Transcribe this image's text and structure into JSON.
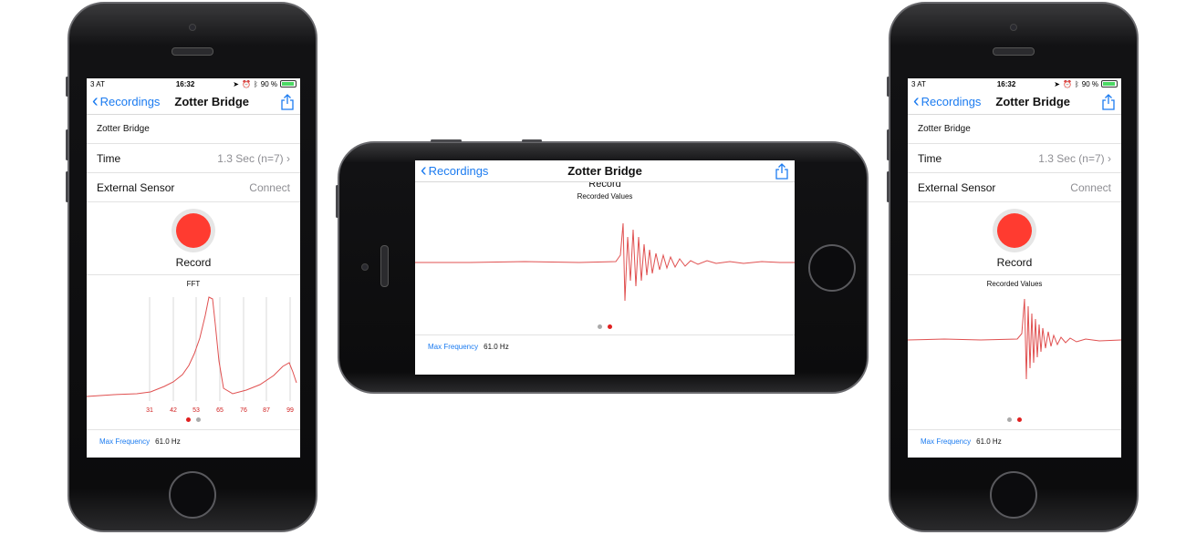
{
  "status": {
    "carrier": "3 AT",
    "time": "16:32",
    "battery": "90 %"
  },
  "nav": {
    "back_label": "Recordings",
    "title": "Zotter Bridge"
  },
  "recording": {
    "name": "Zotter Bridge",
    "time_label": "Time",
    "time_value": "1.3 Sec (n=7)",
    "sensor_label": "External Sensor",
    "sensor_action": "Connect",
    "record_label": "Record"
  },
  "fft": {
    "title": "FFT",
    "peak_labels": [
      "31",
      "42",
      "53",
      "65",
      "76",
      "87",
      "99"
    ]
  },
  "values_chart": {
    "title": "Recorded Values",
    "partial_label": "Record"
  },
  "footer": {
    "max_frequency_label": "Max Frequency",
    "max_frequency_value": "61.0 Hz"
  },
  "colors": {
    "accent": "#1b7bf0",
    "record": "#ff3b30",
    "signal": "#e05050",
    "peak_label": "#d02020"
  }
}
